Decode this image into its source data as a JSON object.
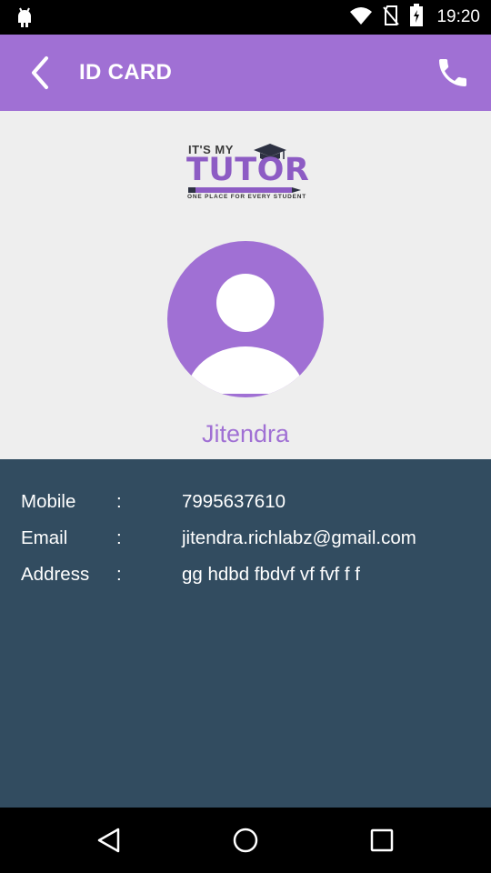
{
  "status_bar": {
    "time": "19:20"
  },
  "app_bar": {
    "title": "ID CARD"
  },
  "logo": {
    "small_text": "IT'S MY",
    "big_text": "TUTOR",
    "tagline": "ONE PLACE FOR EVERY STUDENT"
  },
  "profile": {
    "name": "Jitendra"
  },
  "details": [
    {
      "label": "Mobile",
      "colon": ":",
      "value": "7995637610"
    },
    {
      "label": "Email",
      "colon": ":",
      "value": "jitendra.richlabz@gmail.com"
    },
    {
      "label": "Address",
      "colon": ":",
      "value": "gg hdbd fbdvf vf fvf f f"
    }
  ],
  "colors": {
    "accent": "#a070d4",
    "details_bg": "#324c60",
    "top_bg": "#eeeeee"
  },
  "icons": {
    "back": "back-arrow-icon",
    "call": "phone-icon",
    "avatar": "person-icon",
    "nav_back": "triangle-back-icon",
    "nav_home": "circle-home-icon",
    "nav_recents": "square-recents-icon"
  }
}
